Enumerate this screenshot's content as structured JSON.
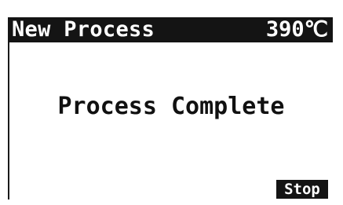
{
  "header": {
    "title": "New Process",
    "temperature": "390℃"
  },
  "main": {
    "status_message": "Process Complete"
  },
  "softkeys": {
    "stop_label": "Stop"
  },
  "colors": {
    "background": "#ffffff",
    "bar": "#141414",
    "text": "#111111"
  }
}
